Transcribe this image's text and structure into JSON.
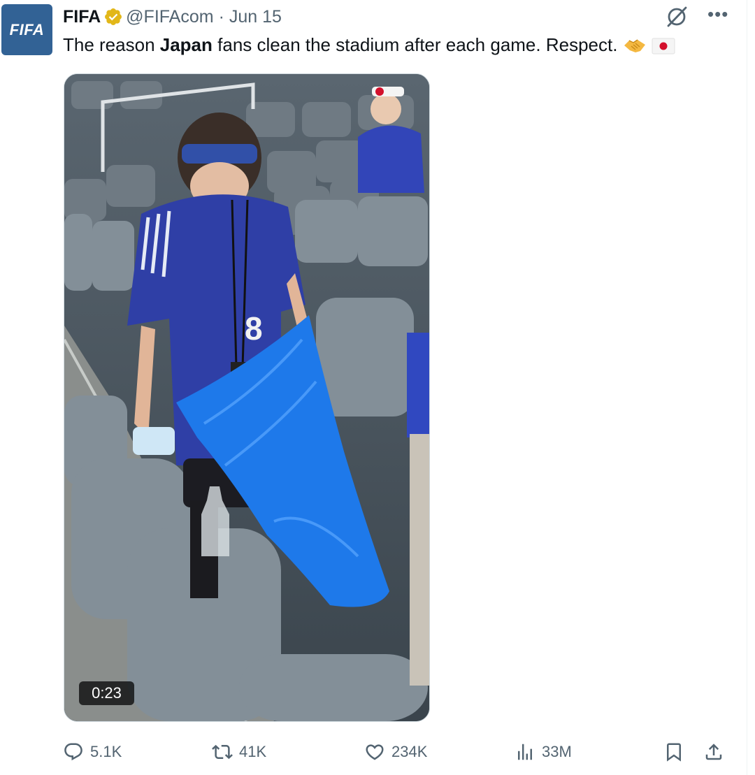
{
  "tweet": {
    "author_logo_text": "FIFA",
    "author_name": "FIFA",
    "handle": "@FIFAcom",
    "separator": "·",
    "date": "Jun 15",
    "text": {
      "before": "The reason ",
      "bold": "Japan",
      "after": " fans clean the stadium after each game. Respect. "
    },
    "emojis": [
      "handshake",
      "japan-flag"
    ],
    "video_duration": "0:23",
    "stats": {
      "replies": "5.1K",
      "reposts": "41K",
      "likes": "234K",
      "views": "33M"
    },
    "icons": [
      "verified-badge-icon",
      "grok-icon",
      "more-icon",
      "reply-icon",
      "repost-icon",
      "like-icon",
      "views-icon",
      "bookmark-icon",
      "share-icon"
    ],
    "colors": {
      "verified": "#e2b719",
      "secondary_text": "#536471",
      "fifa_blue": "#326295"
    }
  }
}
